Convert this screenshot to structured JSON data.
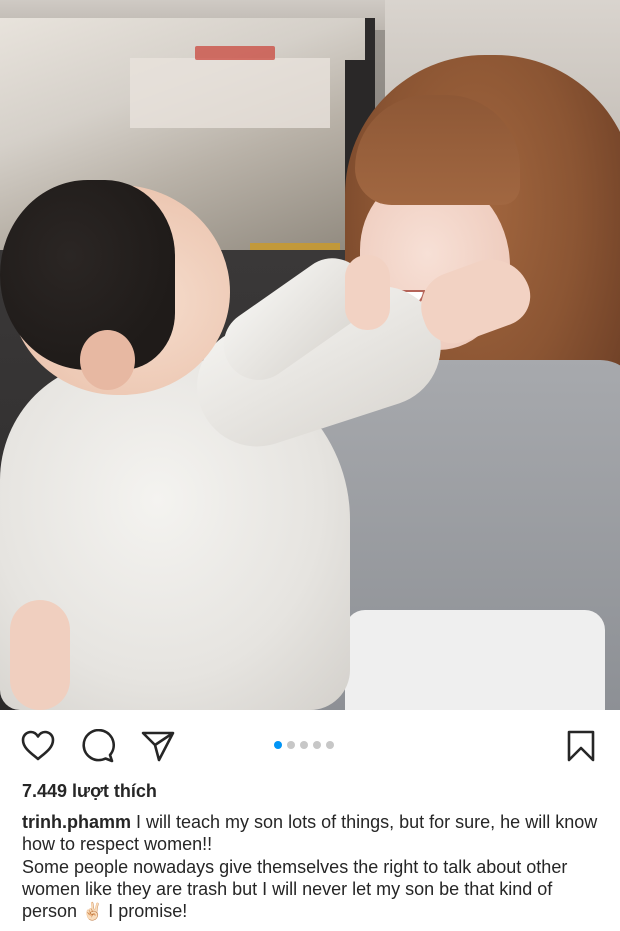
{
  "post": {
    "photo": {
      "alt_content": "photo",
      "carousel_count": 5,
      "carousel_active_index": 0
    },
    "actions": {
      "like_icon": "heart-icon",
      "comment_icon": "comment-icon",
      "share_icon": "paper-plane-icon",
      "save_icon": "bookmark-icon"
    },
    "likes_text": "7.449 lượt thích",
    "caption": {
      "username": "trinh.phamm",
      "line1": " I will teach my son lots of things, but for sure, he will know how to respect women!!",
      "line2_part1": "Some people nowadays give themselves the right to talk about other women like they are trash but I will never let my son be that kind of person ",
      "emoji": "✌🏻",
      "line2_part2": " I promise!"
    },
    "colors": {
      "active_dot": "#0095f6",
      "inactive_dot": "#c7c7c7",
      "text": "#262626"
    }
  }
}
